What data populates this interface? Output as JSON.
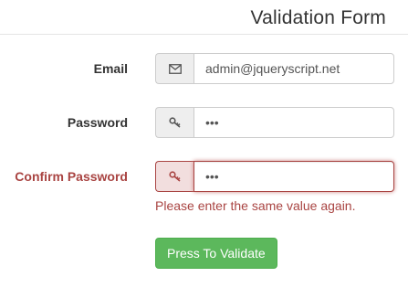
{
  "header": {
    "title": "Validation Form"
  },
  "form": {
    "email": {
      "label": "Email",
      "value": "admin@jqueryscript.net",
      "icon": "envelope-icon"
    },
    "password": {
      "label": "Password",
      "value": "•••",
      "icon": "key-icon"
    },
    "confirm_password": {
      "label": "Confirm Password",
      "value": "•••",
      "icon": "key-icon",
      "error": "Please enter the same value again."
    },
    "submit_label": "Press To Validate"
  },
  "colors": {
    "error": "#a94442",
    "success_button": "#5cb85c",
    "addon_bg": "#eeeeee"
  }
}
